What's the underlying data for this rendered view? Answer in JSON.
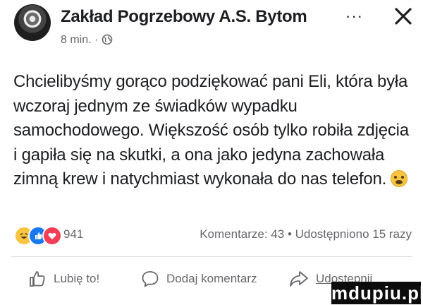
{
  "header": {
    "page_name": "Zakład Pogrzebowy A.S. Bytom",
    "time": "8 min. ·",
    "visibility_icon": "globe-icon",
    "more_label": "···",
    "close_icon": "close-icon"
  },
  "post": {
    "text": "Chcielibyśmy gorąco podziękować pani Eli, która była wczoraj jednym ze świadków wypadku samochodowego. Większość osób tylko robiła zdjęcia i gapiła się na skutki, a ona jako jedyna zachowała zimną krew i natychmiast wykonała do nas telefon.",
    "emoji": "blushing-smile-emoji"
  },
  "engagement": {
    "reactions": [
      "haha",
      "like",
      "love"
    ],
    "reaction_count": "941",
    "stats": "Komentarze: 43 • Udostępniono 15 razy"
  },
  "actions": {
    "like_label": "Lubię to!",
    "comment_label": "Dodaj komentarz",
    "share_label": "Udostępnij"
  },
  "watermark": "mdupiu.pl",
  "colors": {
    "text": "#1c1e21",
    "secondary": "#65676b",
    "like_blue": "#1877f2",
    "love_red": "#f33e58",
    "haha_yellow": "#f7c542"
  }
}
